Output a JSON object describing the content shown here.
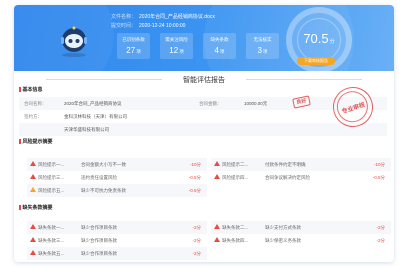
{
  "header": {
    "file_label": "文件名称：",
    "file_name": "2020年合同_产品经销商协议.docx",
    "time_label": "提交时间：",
    "time_value": "2020-12-24 10:00:00"
  },
  "stats": [
    {
      "label": "已识别条款",
      "value": "27",
      "unit": "项"
    },
    {
      "label": "需关注风险",
      "value": "12",
      "unit": "项"
    },
    {
      "label": "缺失条款",
      "value": "4",
      "unit": "项"
    },
    {
      "label": "无法核实",
      "value": "3",
      "unit": "项"
    }
  ],
  "score": {
    "value": "70.5",
    "unit": "分",
    "button": "下载审核报告"
  },
  "report": {
    "title": "智能评估报告"
  },
  "sections": {
    "basic": "基本信息",
    "risk": "风险提示摘要",
    "missing": "缺失条款摘要"
  },
  "basic_info": {
    "contract_name_label": "合同名称：",
    "contract_name": "2020年合同_产品经销商协议",
    "amount_label": "合同金额：",
    "amount": "10000.00元",
    "party_label": "签约方：",
    "party_a": "金科汉林科技（天津）有限公司",
    "party_b": "天津华盛科技有限公司",
    "good_tag": "良好",
    "stamp_text": "专业审核"
  },
  "risks": [
    {
      "name": "风险提示一...",
      "desc": "合同金额大小写不一致",
      "penalty": "-10分",
      "level": "high"
    },
    {
      "name": "风险提示二...",
      "desc": "付款条件约定不明确",
      "penalty": "-10分",
      "level": "high"
    },
    {
      "name": "风险提示三...",
      "desc": "违约责任设置风险",
      "penalty": "-0.5分",
      "level": "high"
    },
    {
      "name": "风险提示四...",
      "desc": "合同争议解决约定风险",
      "penalty": "-0.5分",
      "level": "high"
    },
    {
      "name": "风险提示五...",
      "desc": "缺少不可抗力免责条款",
      "penalty": "-0.5分",
      "level": "warn"
    }
  ],
  "missing": [
    {
      "name": "缺失条款一...",
      "desc": "缺少合作项目条款",
      "penalty": "-2分"
    },
    {
      "name": "缺失条款二...",
      "desc": "缺少支付方式条款",
      "penalty": "-2分"
    },
    {
      "name": "缺失条款三...",
      "desc": "缺少合作项目条款",
      "penalty": "-2分"
    },
    {
      "name": "缺失条款四...",
      "desc": "缺少保密义务条款",
      "penalty": "-2分"
    },
    {
      "name": "缺失条款五...",
      "desc": "缺少合作项目条款",
      "penalty": "-2分"
    }
  ],
  "colors": {
    "brand": "#2f86ec",
    "accent": "#f5a623",
    "danger": "#e54d42"
  }
}
